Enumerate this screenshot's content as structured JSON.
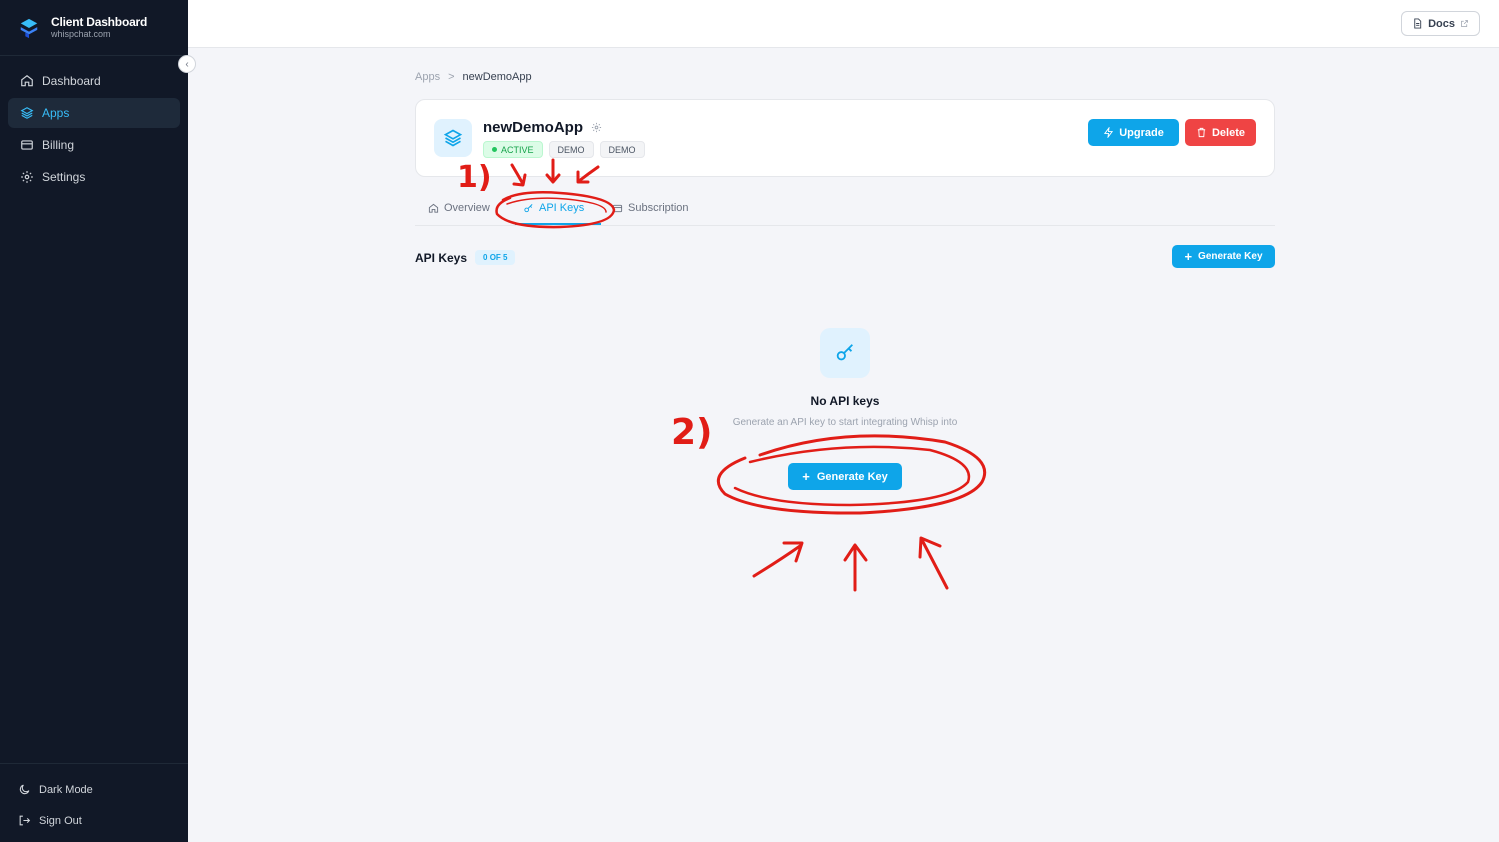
{
  "sidebar": {
    "brand_title": "Client Dashboard",
    "brand_subtitle": "whispchat.com",
    "items": [
      {
        "label": "Dashboard",
        "icon": "home-icon"
      },
      {
        "label": "Apps",
        "icon": "layers-icon",
        "active": true
      },
      {
        "label": "Billing",
        "icon": "card-icon"
      },
      {
        "label": "Settings",
        "icon": "gear-icon"
      }
    ],
    "bottom": {
      "dark_mode": "Dark Mode",
      "sign_out": "Sign Out"
    }
  },
  "topbar": {
    "docs_label": "Docs"
  },
  "breadcrumb": {
    "root": "Apps",
    "separator": ">",
    "current": "newDemoApp"
  },
  "app": {
    "name": "newDemoApp",
    "badges": [
      "ACTIVE",
      "DEMO",
      "DEMO"
    ],
    "upgrade_label": "Upgrade",
    "delete_label": "Delete"
  },
  "tabs": [
    {
      "label": "Overview",
      "icon": "home-icon"
    },
    {
      "label": "API Keys",
      "icon": "key-icon",
      "active": true
    },
    {
      "label": "Subscription",
      "icon": "card-icon"
    }
  ],
  "api_keys": {
    "title": "API Keys",
    "count": "0 OF 5",
    "generate_label": "Generate Key",
    "empty_title": "No API keys",
    "empty_description": "Generate an API key to start integrating Whisp into",
    "empty_button": "Generate Key"
  },
  "annotations": {
    "step1": "1)",
    "step2": "2)"
  },
  "colors": {
    "accent": "#0ea5e9",
    "danger": "#ef4444",
    "sidebar_bg": "#111827",
    "annotation": "#e11d17"
  }
}
